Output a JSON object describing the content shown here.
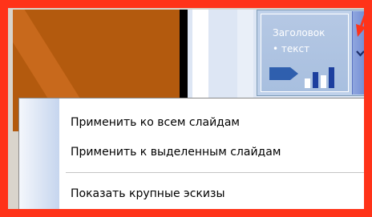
{
  "design_template": {
    "title": "Заголовок",
    "bullet": "• текст"
  },
  "menu": {
    "items": [
      {
        "label": "Применить ко всем слайдам"
      },
      {
        "label": "Применить к выделенным слайдам"
      },
      {
        "label": "Показать крупные эскизы"
      }
    ]
  },
  "colors": {
    "highlight": "#ff3319",
    "slide_background": "#b35a0e",
    "accent": "#6f8ad2"
  }
}
